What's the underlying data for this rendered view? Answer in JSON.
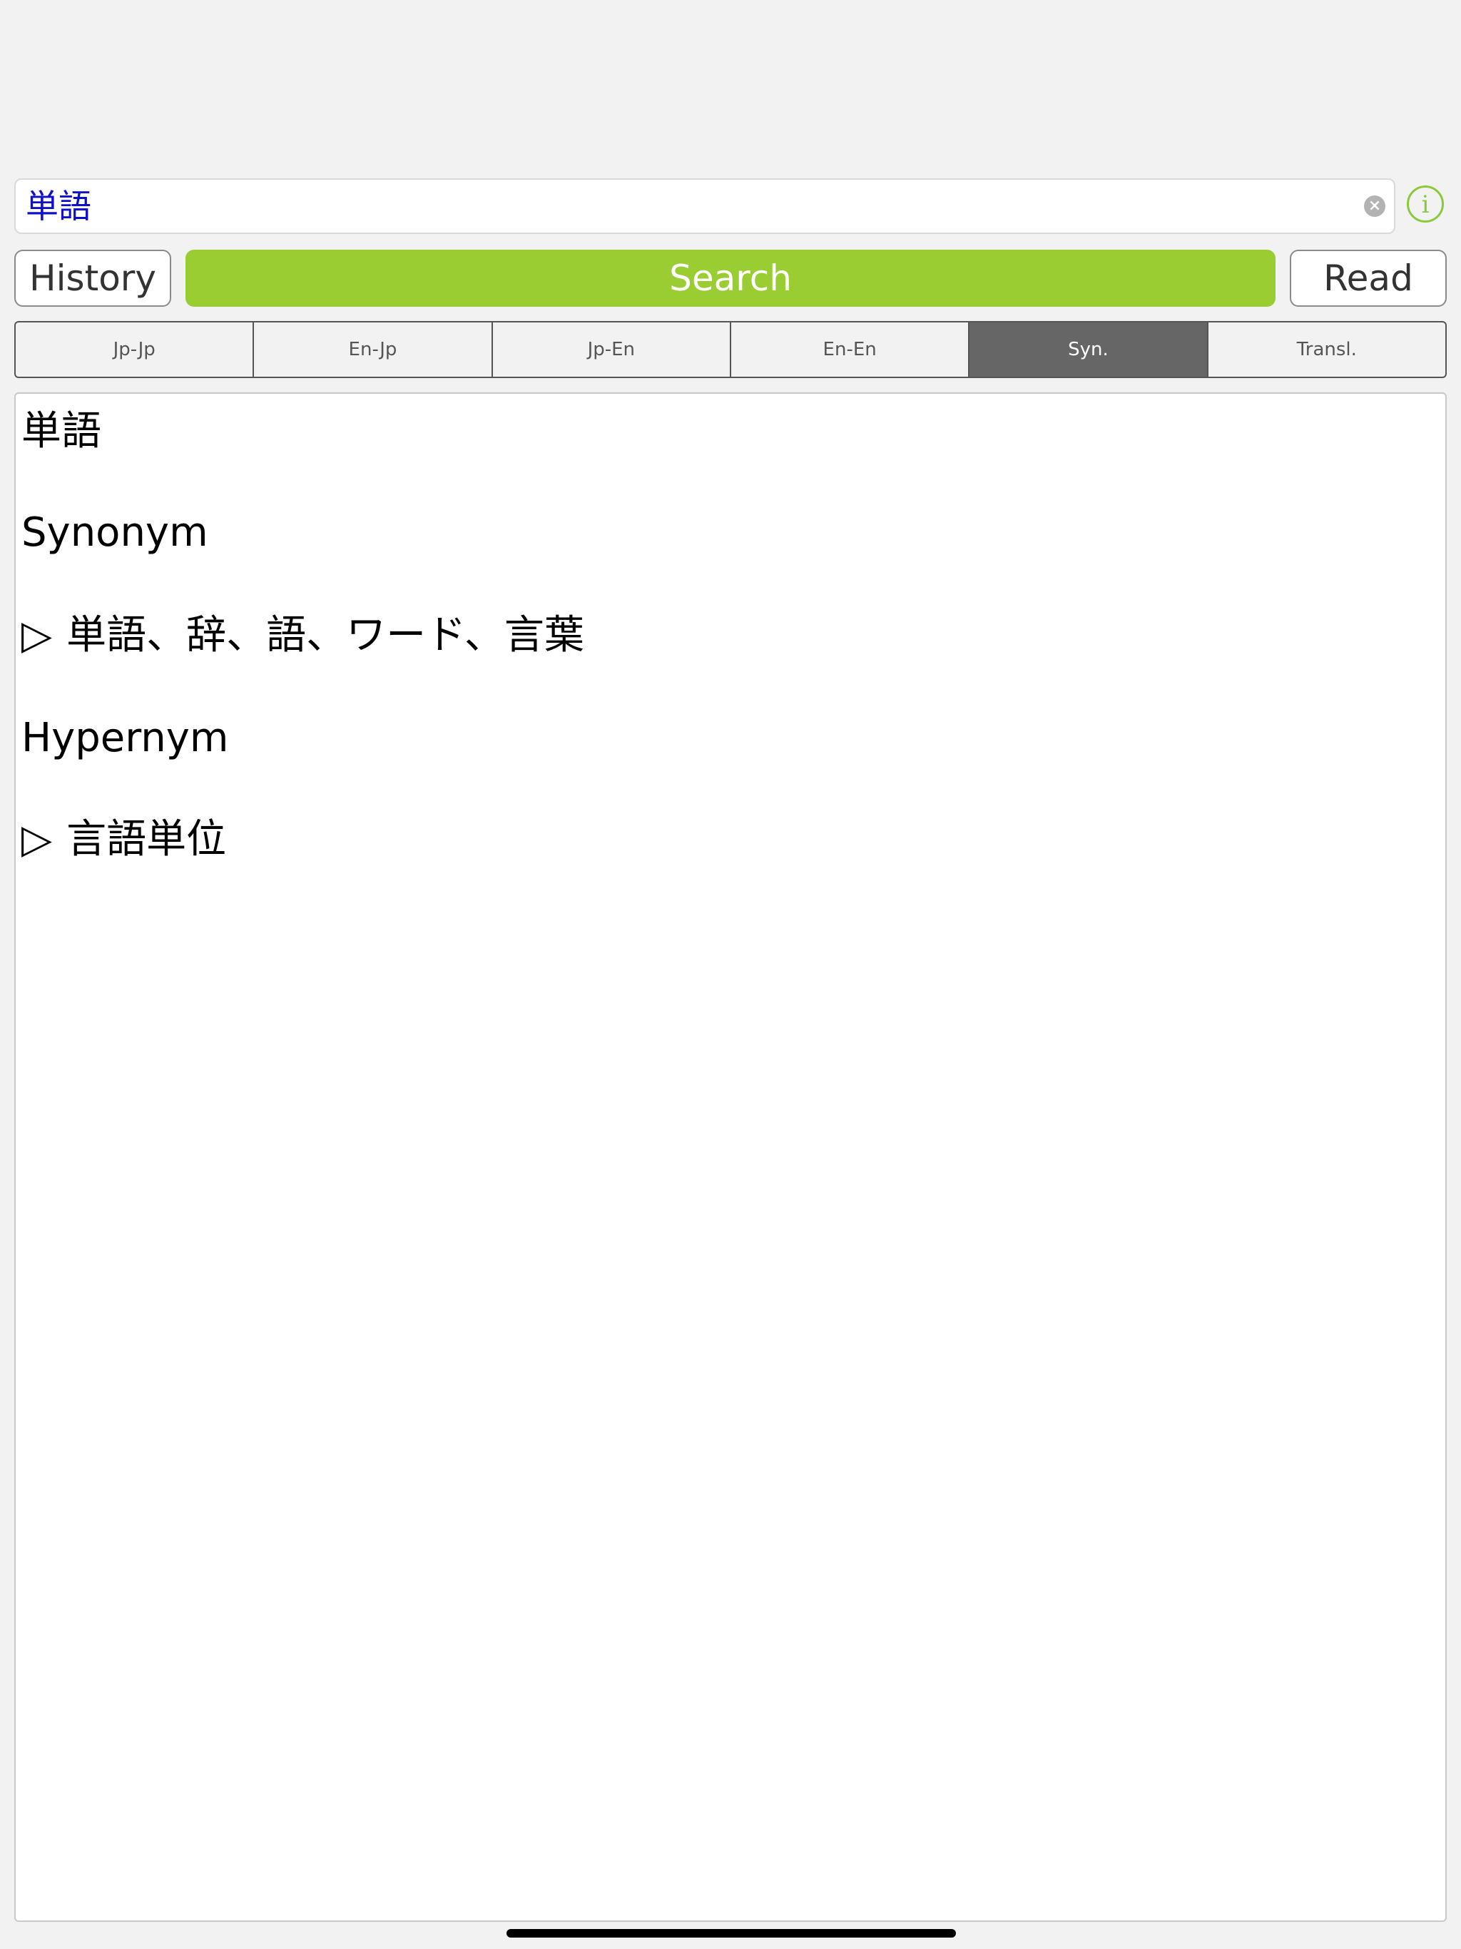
{
  "search": {
    "value": "単語",
    "clear_icon": "clear-icon",
    "info_icon": "info-icon",
    "info_glyph": "i"
  },
  "buttons": {
    "history_label": "History",
    "search_label": "Search",
    "read_label": "Read"
  },
  "tabs": [
    {
      "label": "Jp-Jp",
      "active": false
    },
    {
      "label": "En-Jp",
      "active": false
    },
    {
      "label": "Jp-En",
      "active": false
    },
    {
      "label": "En-En",
      "active": false
    },
    {
      "label": "Syn.",
      "active": true
    },
    {
      "label": "Transl.",
      "active": false
    }
  ],
  "result": {
    "headword": "単語",
    "synonym_heading": "Synonym",
    "synonym_arrow": "▷",
    "synonyms": "単語、辞、語、ワード、言葉",
    "hypernym_heading": "Hypernym",
    "hypernym_arrow": "▷",
    "hypernyms": "言語単位"
  },
  "colors": {
    "accent_green": "#9acd32",
    "query_text": "#1010cc",
    "active_tab": "#666666"
  }
}
